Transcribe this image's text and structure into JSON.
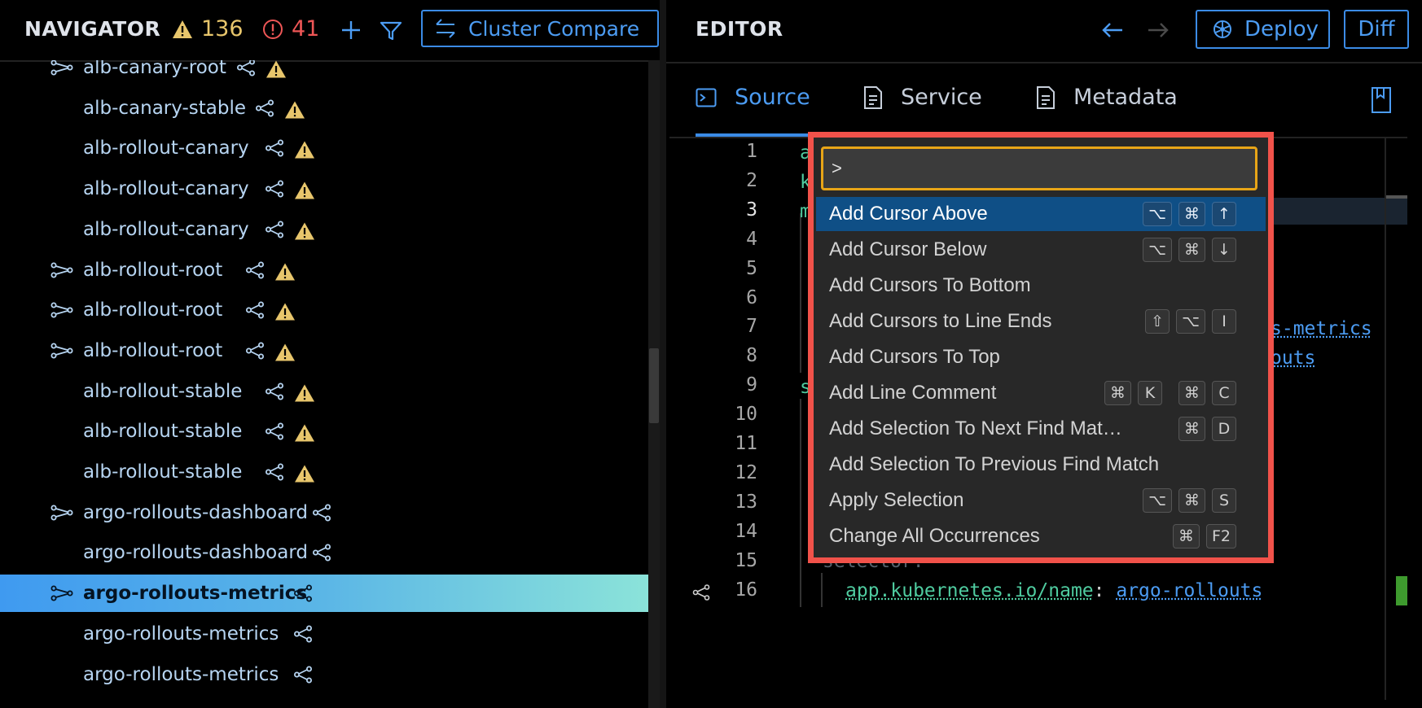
{
  "navigator": {
    "title": "NAVIGATOR",
    "warning_count": "136",
    "error_count": "41",
    "cluster_compare_label": "Cluster Compare",
    "items": [
      {
        "name": "alb-canary-root",
        "expandable": true,
        "warning": true,
        "selected": false
      },
      {
        "name": "alb-canary-stable",
        "expandable": false,
        "warning": true,
        "selected": false
      },
      {
        "name": "alb-rollout-canary",
        "expandable": false,
        "warning": true,
        "selected": false
      },
      {
        "name": "alb-rollout-canary",
        "expandable": false,
        "warning": true,
        "selected": false
      },
      {
        "name": "alb-rollout-canary",
        "expandable": false,
        "warning": true,
        "selected": false
      },
      {
        "name": "alb-rollout-root",
        "expandable": true,
        "warning": true,
        "selected": false
      },
      {
        "name": "alb-rollout-root",
        "expandable": true,
        "warning": true,
        "selected": false
      },
      {
        "name": "alb-rollout-root",
        "expandable": true,
        "warning": true,
        "selected": false
      },
      {
        "name": "alb-rollout-stable",
        "expandable": false,
        "warning": true,
        "selected": false
      },
      {
        "name": "alb-rollout-stable",
        "expandable": false,
        "warning": true,
        "selected": false
      },
      {
        "name": "alb-rollout-stable",
        "expandable": false,
        "warning": true,
        "selected": false
      },
      {
        "name": "argo-rollouts-dashboard",
        "expandable": true,
        "warning": false,
        "selected": false
      },
      {
        "name": "argo-rollouts-dashboard",
        "expandable": false,
        "warning": false,
        "selected": false
      },
      {
        "name": "argo-rollouts-metrics",
        "expandable": true,
        "warning": false,
        "selected": true
      },
      {
        "name": "argo-rollouts-metrics",
        "expandable": false,
        "warning": false,
        "selected": false
      },
      {
        "name": "argo-rollouts-metrics",
        "expandable": false,
        "warning": false,
        "selected": false
      }
    ]
  },
  "editor": {
    "title": "EDITOR",
    "deploy_label": "Deploy",
    "diff_label": "Diff",
    "tabs": [
      {
        "label": "Source",
        "active": true
      },
      {
        "label": "Service",
        "active": false
      },
      {
        "label": "Metadata",
        "active": false
      }
    ],
    "line_numbers": [
      "1",
      "2",
      "3",
      "4",
      "5",
      "6",
      "7",
      "8",
      "9",
      "10",
      "11",
      "12",
      "13",
      "14",
      "15",
      "16"
    ],
    "active_line": "3",
    "visible_code": {
      "line1_start": "a",
      "line2_start": "k",
      "line3_start": "m",
      "line7_tail": "s-metrics",
      "line8_tail": "outs",
      "line9_start": "s",
      "line15_partial": "selector:",
      "line16_key": "app.kubernetes.io/name",
      "line16_sep": ":",
      "line16_value": "argo-rollouts"
    }
  },
  "command_palette": {
    "input_value": ">",
    "selected_index": 0,
    "commands": [
      {
        "label": "Add Cursor Above",
        "keys": [
          [
            "⌥",
            "⌘",
            "↑"
          ]
        ]
      },
      {
        "label": "Add Cursor Below",
        "keys": [
          [
            "⌥",
            "⌘",
            "↓"
          ]
        ]
      },
      {
        "label": "Add Cursors To Bottom",
        "keys": []
      },
      {
        "label": "Add Cursors to Line Ends",
        "keys": [
          [
            "⇧",
            "⌥",
            "I"
          ]
        ]
      },
      {
        "label": "Add Cursors To Top",
        "keys": []
      },
      {
        "label": "Add Line Comment",
        "keys": [
          [
            "⌘",
            "K"
          ],
          [
            "⌘",
            "C"
          ]
        ]
      },
      {
        "label": "Add Selection To Next Find Mat…",
        "keys": [
          [
            "⌘",
            "D"
          ]
        ]
      },
      {
        "label": "Add Selection To Previous Find Match",
        "keys": []
      },
      {
        "label": "Apply Selection",
        "keys": [
          [
            "⌥",
            "⌘",
            "S"
          ]
        ]
      },
      {
        "label": "Change All Occurrences",
        "keys": [
          [
            "⌘",
            "F2"
          ]
        ]
      }
    ]
  },
  "icons": {
    "warning": "warning-triangle-icon",
    "error": "error-circle-icon",
    "add": "plus-icon",
    "filter": "filter-icon",
    "compare": "compare-arrows-icon",
    "back": "arrow-left-icon",
    "forward": "arrow-right-icon",
    "deploy": "kubernetes-helm-icon",
    "bookmark": "bookmark-icon",
    "source": "terminal-icon",
    "service": "document-icon",
    "metadata": "document-icon",
    "expand": "tree-expand-icon",
    "references": "share-nodes-icon"
  },
  "colors": {
    "accent": "#3b8be6",
    "warning": "#e8c66c",
    "error": "#ee5656",
    "selection": "#0f4f86",
    "palette_highlight": "#f1524a",
    "input_focus": "#e8a517",
    "git_added": "#3e9b2e"
  }
}
